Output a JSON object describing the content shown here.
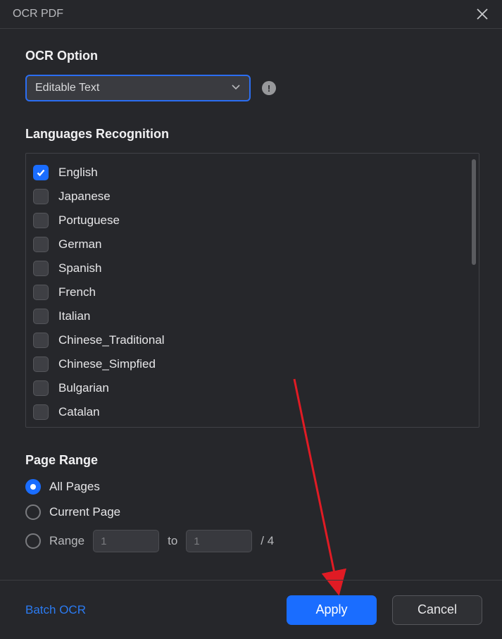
{
  "dialog": {
    "title": "OCR PDF"
  },
  "ocr_option": {
    "label": "OCR Option",
    "selected": "Editable Text"
  },
  "languages": {
    "label": "Languages Recognition",
    "items": [
      {
        "name": "English",
        "checked": true
      },
      {
        "name": "Japanese",
        "checked": false
      },
      {
        "name": "Portuguese",
        "checked": false
      },
      {
        "name": "German",
        "checked": false
      },
      {
        "name": "Spanish",
        "checked": false
      },
      {
        "name": "French",
        "checked": false
      },
      {
        "name": "Italian",
        "checked": false
      },
      {
        "name": "Chinese_Traditional",
        "checked": false
      },
      {
        "name": "Chinese_Simpfied",
        "checked": false
      },
      {
        "name": "Bulgarian",
        "checked": false
      },
      {
        "name": "Catalan",
        "checked": false
      }
    ]
  },
  "page_range": {
    "label": "Page Range",
    "all_pages": "All Pages",
    "current_page": "Current Page",
    "range": "Range",
    "to": "to",
    "from_value": "1",
    "to_value": "1",
    "total": "/ 4",
    "selected": "all"
  },
  "footer": {
    "batch": "Batch OCR",
    "apply": "Apply",
    "cancel": "Cancel"
  }
}
